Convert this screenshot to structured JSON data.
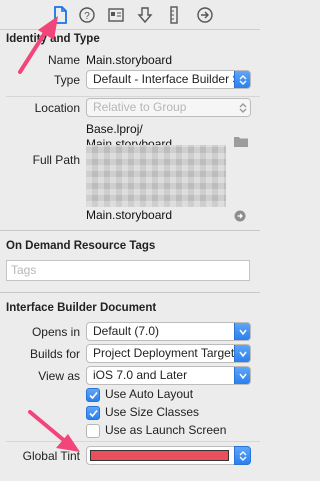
{
  "toolbar": {
    "icons": [
      "file-inspector-icon",
      "quick-help-icon",
      "identity-inspector-icon",
      "attributes-inspector-icon",
      "size-inspector-icon",
      "connections-inspector-icon"
    ]
  },
  "identity": {
    "header": "Identity and Type",
    "name_label": "Name",
    "name_value": "Main.storyboard",
    "type_label": "Type",
    "type_value": "Default - Interface Builder Storyboard",
    "location_label": "Location",
    "location_value": "Relative to Group",
    "location_path_1": "Base.lproj/",
    "location_path_2": "Main.storyboard",
    "full_path_label": "Full Path",
    "full_path_end": "Main.storyboard"
  },
  "on_demand": {
    "header": "On Demand Resource Tags",
    "tags_placeholder": "Tags"
  },
  "ib_document": {
    "header": "Interface Builder Document",
    "opens_in_label": "Opens in",
    "opens_in_value": "Default (7.0)",
    "builds_for_label": "Builds for",
    "builds_for_value": "Project Deployment Target",
    "view_as_label": "View as",
    "view_as_value": "iOS 7.0 and Later",
    "checkboxes": [
      {
        "label": "Use Auto Layout",
        "checked": true
      },
      {
        "label": "Use Size Classes",
        "checked": true
      },
      {
        "label": "Use as Launch Screen",
        "checked": false
      }
    ]
  },
  "global_tint": {
    "label": "Global Tint",
    "color": "#e8515c"
  },
  "colors": {
    "accent_blue": "#2a7ff0",
    "annotation_arrow": "#f2457a"
  }
}
